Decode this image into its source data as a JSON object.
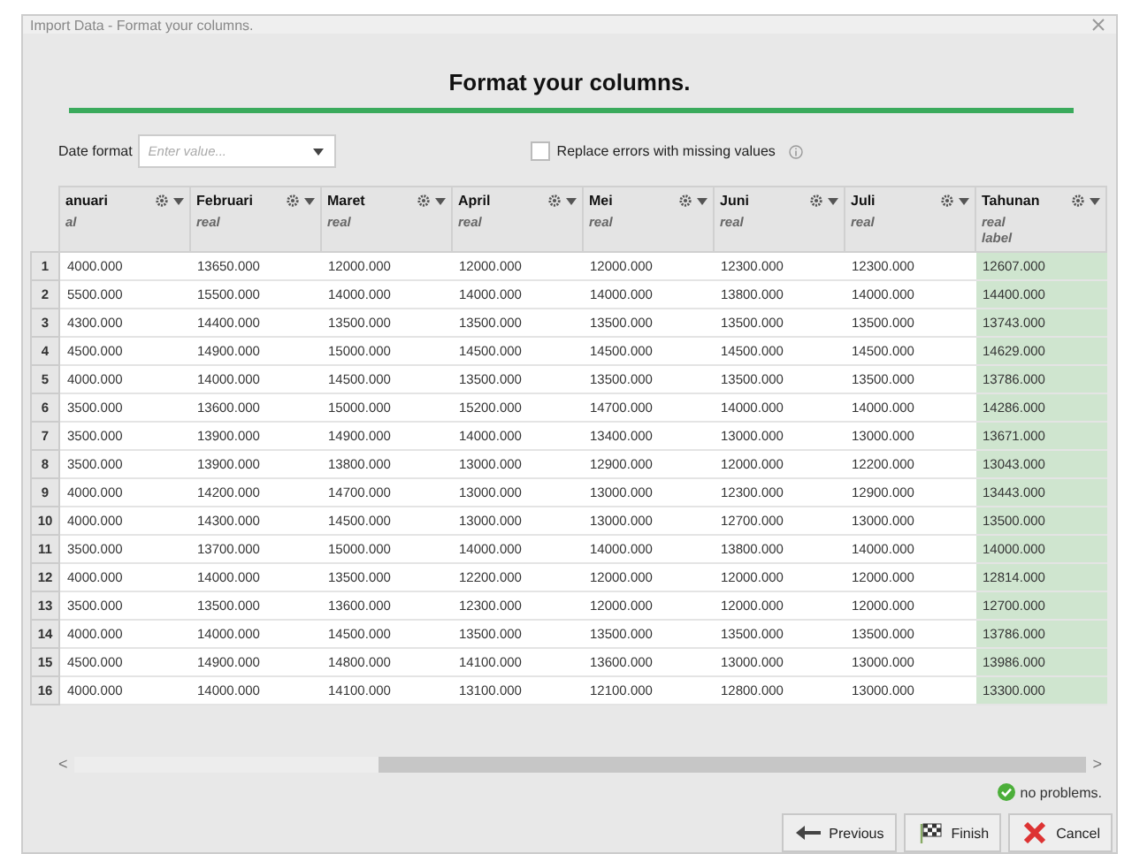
{
  "window": {
    "title": "Import Data - Format your columns."
  },
  "heading": "Format your columns.",
  "progress": {
    "level": 1
  },
  "date_format": {
    "label": "Date format",
    "placeholder": "Enter value..."
  },
  "replace_errors": {
    "label": "Replace errors with missing values",
    "checked": false
  },
  "table": {
    "columns": [
      {
        "name": "anuari",
        "type": "al"
      },
      {
        "name": "Februari",
        "type": "real"
      },
      {
        "name": "Maret",
        "type": "real"
      },
      {
        "name": "April",
        "type": "real"
      },
      {
        "name": "Mei",
        "type": "real"
      },
      {
        "name": "Juni",
        "type": "real"
      },
      {
        "name": "Juli",
        "type": "real"
      },
      {
        "name": "Tahunan",
        "type": "real",
        "role": "label"
      }
    ],
    "rows": [
      {
        "number": "1",
        "cells": [
          "4000.000",
          "13650.000",
          "12000.000",
          "12000.000",
          "12000.000",
          "12300.000",
          "12300.000",
          "12607.000"
        ]
      },
      {
        "number": "2",
        "cells": [
          "5500.000",
          "15500.000",
          "14000.000",
          "14000.000",
          "14000.000",
          "13800.000",
          "14000.000",
          "14400.000"
        ]
      },
      {
        "number": "3",
        "cells": [
          "4300.000",
          "14400.000",
          "13500.000",
          "13500.000",
          "13500.000",
          "13500.000",
          "13500.000",
          "13743.000"
        ]
      },
      {
        "number": "4",
        "cells": [
          "4500.000",
          "14900.000",
          "15000.000",
          "14500.000",
          "14500.000",
          "14500.000",
          "14500.000",
          "14629.000"
        ]
      },
      {
        "number": "5",
        "cells": [
          "4000.000",
          "14000.000",
          "14500.000",
          "13500.000",
          "13500.000",
          "13500.000",
          "13500.000",
          "13786.000"
        ]
      },
      {
        "number": "6",
        "cells": [
          "3500.000",
          "13600.000",
          "15000.000",
          "15200.000",
          "14700.000",
          "14000.000",
          "14000.000",
          "14286.000"
        ]
      },
      {
        "number": "7",
        "cells": [
          "3500.000",
          "13900.000",
          "14900.000",
          "14000.000",
          "13400.000",
          "13000.000",
          "13000.000",
          "13671.000"
        ]
      },
      {
        "number": "8",
        "cells": [
          "3500.000",
          "13900.000",
          "13800.000",
          "13000.000",
          "12900.000",
          "12000.000",
          "12200.000",
          "13043.000"
        ]
      },
      {
        "number": "9",
        "cells": [
          "4000.000",
          "14200.000",
          "14700.000",
          "13000.000",
          "13000.000",
          "12300.000",
          "12900.000",
          "13443.000"
        ]
      },
      {
        "number": "10",
        "cells": [
          "4000.000",
          "14300.000",
          "14500.000",
          "13000.000",
          "13000.000",
          "12700.000",
          "13000.000",
          "13500.000"
        ]
      },
      {
        "number": "11",
        "cells": [
          "3500.000",
          "13700.000",
          "15000.000",
          "14000.000",
          "14000.000",
          "13800.000",
          "14000.000",
          "14000.000"
        ]
      },
      {
        "number": "12",
        "cells": [
          "4000.000",
          "14000.000",
          "13500.000",
          "12200.000",
          "12000.000",
          "12000.000",
          "12000.000",
          "12814.000"
        ]
      },
      {
        "number": "13",
        "cells": [
          "3500.000",
          "13500.000",
          "13600.000",
          "12300.000",
          "12000.000",
          "12000.000",
          "12000.000",
          "12700.000"
        ]
      },
      {
        "number": "14",
        "cells": [
          "4000.000",
          "14000.000",
          "14500.000",
          "13500.000",
          "13500.000",
          "13500.000",
          "13500.000",
          "13786.000"
        ]
      },
      {
        "number": "15",
        "cells": [
          "4500.000",
          "14900.000",
          "14800.000",
          "14100.000",
          "13600.000",
          "13000.000",
          "13000.000",
          "13986.000"
        ]
      },
      {
        "number": "16",
        "cells": [
          "4000.000",
          "14000.000",
          "14100.000",
          "13100.000",
          "12100.000",
          "12800.000",
          "13000.000",
          "13300.000"
        ]
      }
    ]
  },
  "scrollbar": {
    "left_arrow": "<",
    "right_arrow": ">"
  },
  "status": "no problems.",
  "buttons": [
    {
      "kind": "previous",
      "label": "Previous"
    },
    {
      "kind": "finish",
      "label": "Finish"
    },
    {
      "kind": "cancel",
      "label": "Cancel"
    }
  ]
}
